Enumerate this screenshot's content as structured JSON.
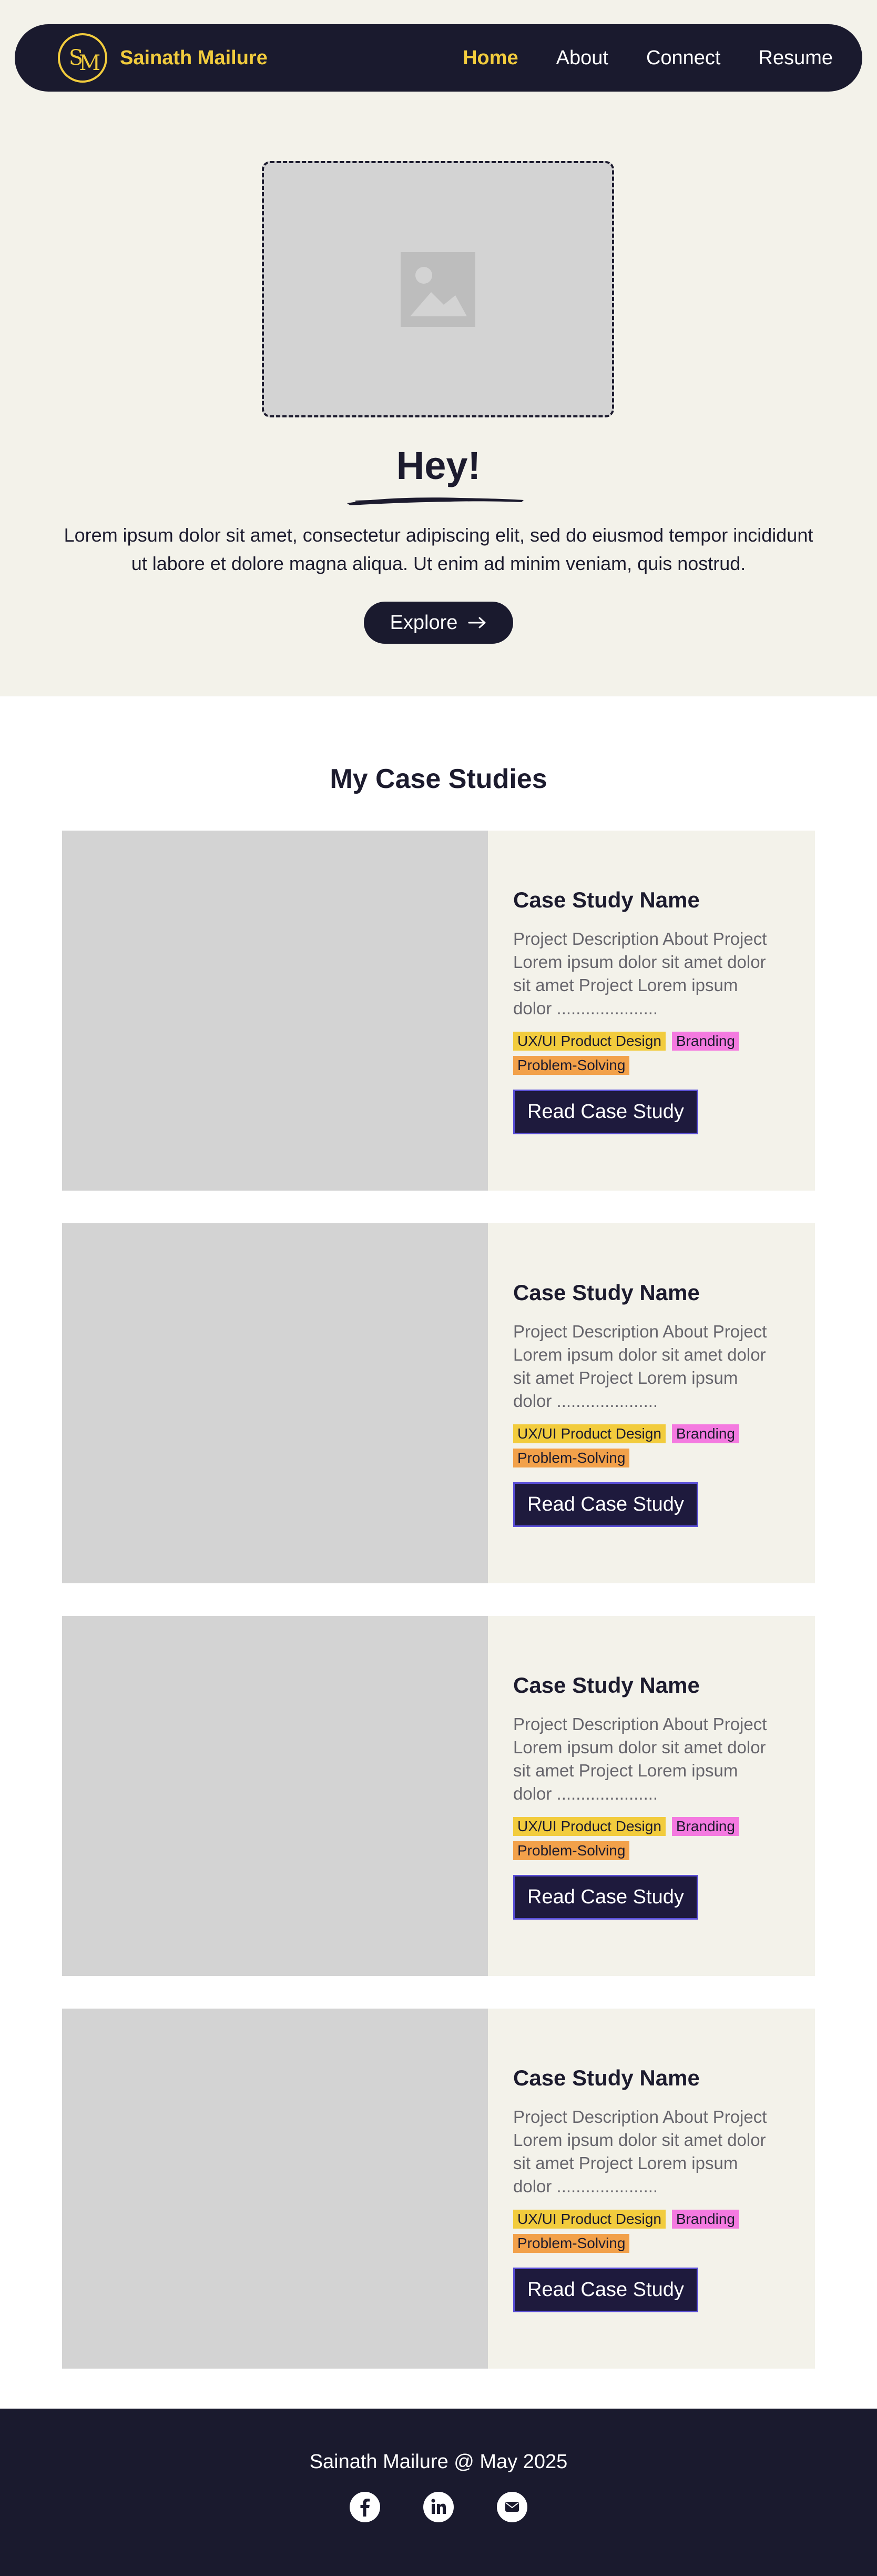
{
  "nav": {
    "logo_text": "SM",
    "brand": "Sainath Mailure",
    "links": [
      "Home",
      "About",
      "Connect",
      "Resume"
    ],
    "active": "Home"
  },
  "hero": {
    "title": "Hey!",
    "text": "Lorem ipsum dolor sit amet, consectetur adipiscing elit, sed do eiusmod tempor incididunt ut labore et dolore magna aliqua. Ut enim ad minim veniam, quis nostrud.",
    "button_label": "Explore"
  },
  "case_studies": {
    "title": "My Case Studies",
    "cards": [
      {
        "name": "Case Study Name",
        "description": "Project Description About Project Lorem ipsum dolor sit amet dolor sit amet Project Lorem ipsum dolor .....................",
        "tags": [
          "UX/UI Product Design",
          "Branding",
          "Problem-Solving"
        ],
        "button_label": "Read Case Study"
      },
      {
        "name": "Case Study Name",
        "description": "Project Description About Project Lorem ipsum dolor sit amet dolor sit amet Project Lorem ipsum dolor .....................",
        "tags": [
          "UX/UI Product Design",
          "Branding",
          "Problem-Solving"
        ],
        "button_label": "Read Case Study"
      },
      {
        "name": "Case Study Name",
        "description": "Project Description About Project Lorem ipsum dolor sit amet dolor sit amet Project Lorem ipsum dolor .....................",
        "tags": [
          "UX/UI Product Design",
          "Branding",
          "Problem-Solving"
        ],
        "button_label": "Read Case Study"
      },
      {
        "name": "Case Study Name",
        "description": "Project Description About Project Lorem ipsum dolor sit amet dolor sit amet Project Lorem ipsum dolor .....................",
        "tags": [
          "UX/UI Product Design",
          "Branding",
          "Problem-Solving"
        ],
        "button_label": "Read Case Study"
      }
    ]
  },
  "footer": {
    "text": "Sainath Mailure @ May 2025",
    "social_icons": [
      "facebook-icon",
      "linkedin-icon",
      "email-icon"
    ]
  },
  "colors": {
    "navy": "#1a1a2e",
    "accent_yellow": "#f2cc3d",
    "cream": "#f3f2ea",
    "placeholder_gray": "#d3d3d3",
    "tag_pink": "#f47ae0",
    "tag_orange": "#f2a14a"
  }
}
